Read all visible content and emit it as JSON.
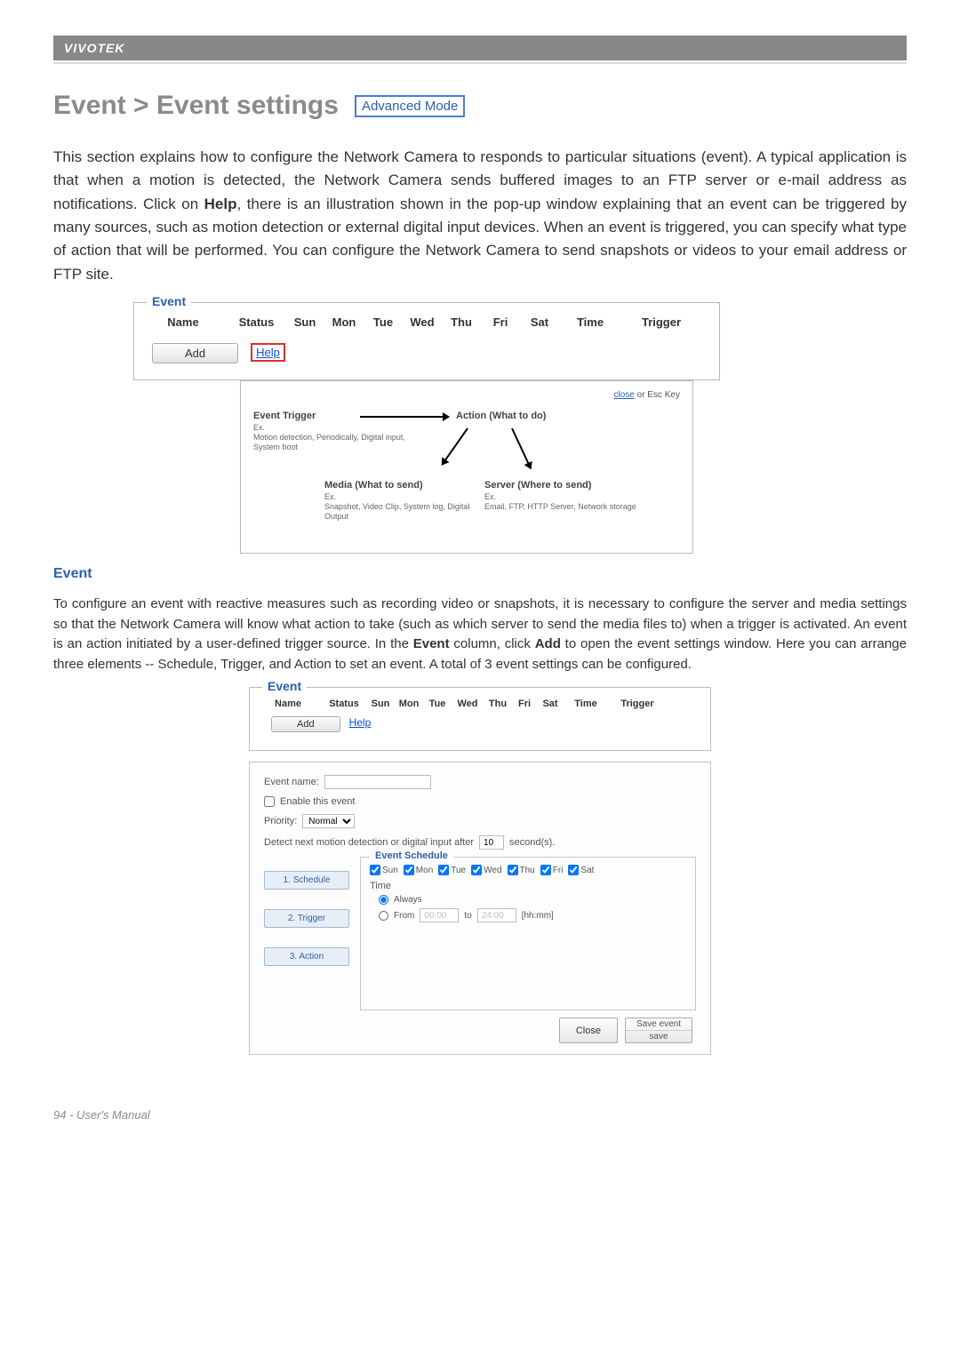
{
  "brand": "VIVOTEK",
  "page_title": "Event > Event settings",
  "mode_badge": "Advanced Mode",
  "intro_paragraph_pre": "This section explains how to configure the Network Camera to responds to particular situations (event). A typical application is that when a motion is detected, the Network Camera sends buffered images to an FTP server or e-mail address as notifications. Click on ",
  "intro_bold": "Help",
  "intro_paragraph_post": ", there is an illustration shown in the pop-up window explaining that an event can be triggered by many sources, such as motion detection or external digital input devices. When an event is triggered, you can specify what type of action that will be performed. You can configure the Network Camera to send snapshots or videos to your email address or FTP site.",
  "event_fieldset_label": "Event",
  "event_table_headers": {
    "name": "Name",
    "status": "Status",
    "days": [
      "Sun",
      "Mon",
      "Tue",
      "Wed",
      "Thu",
      "Fri",
      "Sat"
    ],
    "time": "Time",
    "trigger": "Trigger"
  },
  "add_button": "Add",
  "help_link": "Help",
  "popup": {
    "close_word": "close",
    "close_suffix": " or Esc Key",
    "trigger_title": "Event Trigger",
    "trigger_ex_label": "Ex.",
    "trigger_ex": "Motion detection, Periodically, Digital input, System boot",
    "action_title": "Action (What to do)",
    "media_title": "Media (What to send)",
    "media_ex_label": "Ex.",
    "media_ex": "Snapshot, Video Clip, System log, Digital Output",
    "server_title": "Server (Where to send)",
    "server_ex_label": "Ex.",
    "server_ex": "Email, FTP, HTTP Server, Network storage"
  },
  "section_heading": "Event",
  "para2_pre": "To configure an event with reactive measures such as recording video or snapshots, it is necessary to configure the server and media settings so that the Network Camera will know what action to take (such as which server to send the media files to) when a trigger is activated. An event is an action initiated by a user-defined trigger source. In the ",
  "para2_b1": "Event",
  "para2_mid": "  column, click ",
  "para2_b2": "Add",
  "para2_post": " to open the event settings window. Here you can arrange three elements -- Schedule, Trigger, and Action to set an event. A total of 3 event settings can be configured.",
  "settings_panel": {
    "event_name_label": "Event name:",
    "enable_label": "Enable this event",
    "priority_label": "Priority:",
    "priority_value": "Normal",
    "detect_pre": "Detect next motion detection or digital input after",
    "detect_value": "10",
    "detect_post": "second(s).",
    "schedule_legend": "Event Schedule",
    "days": [
      "Sun",
      "Mon",
      "Tue",
      "Wed",
      "Thu",
      "Fri",
      "Sat"
    ],
    "time_label": "Time",
    "always_label": "Always",
    "from_label": "From",
    "from_value": "00:00",
    "to_label": "to",
    "to_value": "24:00",
    "hhmm_label": "[hh:mm]",
    "steps": [
      "1. Schedule",
      "2. Trigger",
      "3. Action"
    ],
    "close_btn": "Close",
    "save_top": "Save event",
    "save_bottom": "save"
  },
  "footer": "94 - User's Manual"
}
